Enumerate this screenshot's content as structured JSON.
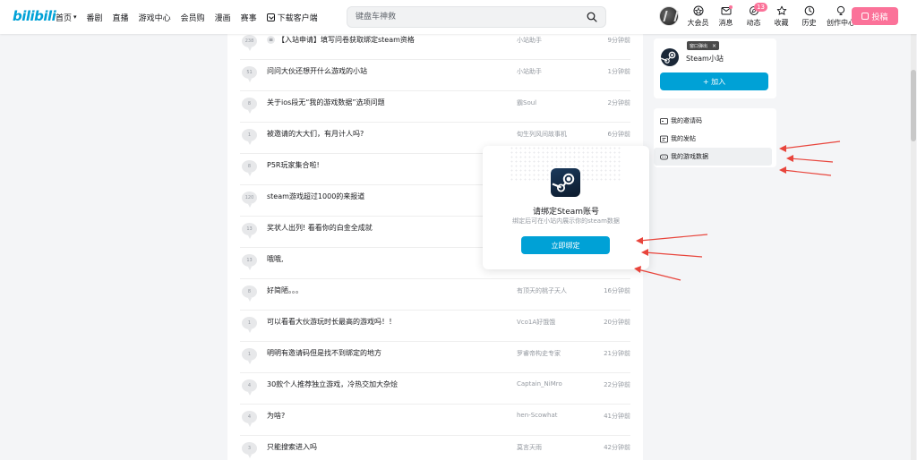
{
  "header": {
    "logo": "bilibili",
    "nav": [
      {
        "label": "首页",
        "has_chevron": true
      },
      {
        "label": "番剧"
      },
      {
        "label": "直播"
      },
      {
        "label": "游戏中心"
      },
      {
        "label": "会员购"
      },
      {
        "label": "漫画"
      },
      {
        "label": "赛事"
      },
      {
        "label": "下载客户端"
      }
    ],
    "search_placeholder": "键盘车神救",
    "right_nav": {
      "vip": "大会员",
      "messages": "消息",
      "dynamics": "动态",
      "dynamics_badge": "13",
      "favorites": "收藏",
      "history": "历史",
      "creator": "创作中心"
    },
    "upload_label": "投稿"
  },
  "threads": [
    {
      "replies": "238",
      "title": "【入站申请】填写问卷获取绑定steam资格",
      "author": "小站助手",
      "time": "9分钟前",
      "pinned": true
    },
    {
      "replies": "51",
      "title": "问问大伙还想开什么游戏的小站",
      "author": "小站助手",
      "time": "1分钟前"
    },
    {
      "replies": "8",
      "title": "关于ios段无“我的游戏数据”选项问题",
      "author": "霸Soul",
      "time": "2分钟前"
    },
    {
      "replies": "1",
      "title": "被邀请的大大们，有月计人吗?",
      "author": "旬生列风间故事机",
      "time": "6分钟前"
    },
    {
      "replies": "8",
      "title": "P5R玩家集合啦!",
      "author": "",
      "time": ""
    },
    {
      "replies": "120",
      "title": "steam游戏超过1000的来报道",
      "author": "",
      "time": ""
    },
    {
      "replies": "13",
      "title": "奖状人出列!  看看你的白金全成就",
      "author": "",
      "time": ""
    },
    {
      "replies": "13",
      "title": "哦哦,",
      "author": "",
      "time": ""
    },
    {
      "replies": "8",
      "title": "好简陋。。。",
      "author": "有顶天的桃子天人",
      "time": "16分钟前"
    },
    {
      "replies": "1",
      "title": "可以看看大伙游玩时长最高的游戏吗！！",
      "author": "Vco1A好饿饿",
      "time": "20分钟前"
    },
    {
      "replies": "1",
      "title": "明明有邀请码但是找不到绑定的地方",
      "author": "罗睿帝构史专家",
      "time": "21分钟前"
    },
    {
      "replies": "4",
      "title": "30款个人推荐独立游戏，冷热交加大杂烩",
      "author": "Captain_NiMro",
      "time": "22分钟前"
    },
    {
      "replies": "4",
      "title": "为啥?",
      "author": "hen-Scowhat",
      "time": "41分钟前"
    },
    {
      "replies": "3",
      "title": "只能搜索进入吗",
      "author": "莫言天雨",
      "time": "42分钟前"
    }
  ],
  "sidebar": {
    "tooltip": "窗口弹出",
    "tooltip_close": "×",
    "site_name": "Steam小站",
    "join_label": "+ 加入",
    "menu": [
      {
        "label": "我的邀请码"
      },
      {
        "label": "我的发帖"
      },
      {
        "label": "我的游戏数据",
        "active": true
      }
    ]
  },
  "modal": {
    "title": "请绑定Steam账号",
    "subtitle": "绑定后可在小站内展示你的steam数据",
    "button": "立即绑定"
  },
  "colors": {
    "accent": "#00a1d6",
    "pink": "#fb7299",
    "annotation": "#e8453c"
  }
}
